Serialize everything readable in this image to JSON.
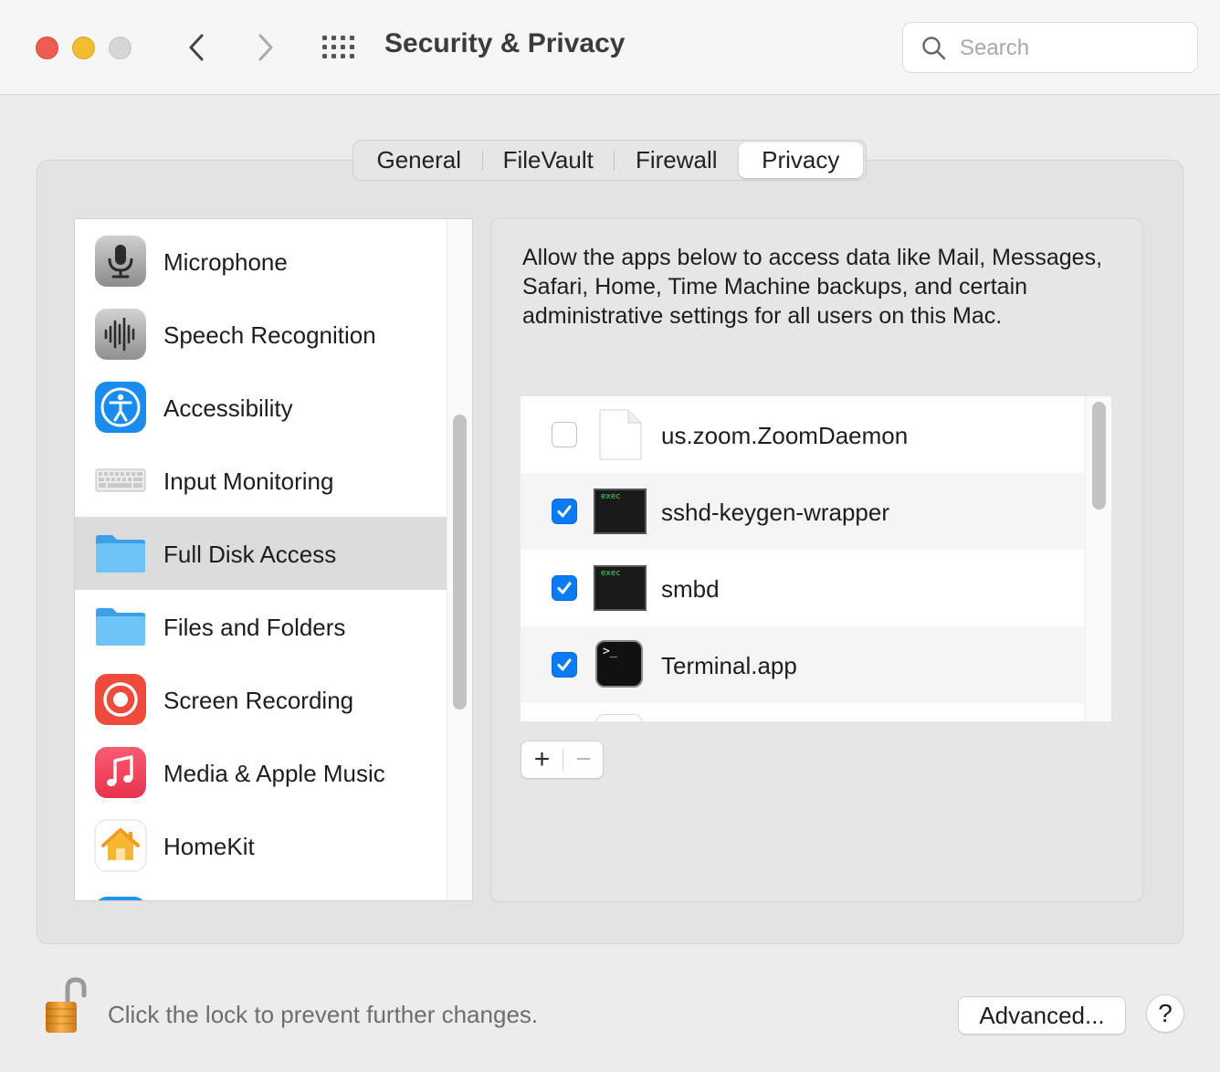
{
  "window": {
    "title": "Security & Privacy"
  },
  "search": {
    "placeholder": "Search",
    "icon": "magnifying-glass-icon"
  },
  "tabs": [
    {
      "label": "General",
      "selected": false
    },
    {
      "label": "FileVault",
      "selected": false
    },
    {
      "label": "Firewall",
      "selected": false
    },
    {
      "label": "Privacy",
      "selected": true
    }
  ],
  "sidebar": {
    "items": [
      {
        "label": "Microphone",
        "icon": "microphone-icon"
      },
      {
        "label": "Speech Recognition",
        "icon": "waveform-icon"
      },
      {
        "label": "Accessibility",
        "icon": "accessibility-icon"
      },
      {
        "label": "Input Monitoring",
        "icon": "keyboard-icon"
      },
      {
        "label": "Full Disk Access",
        "icon": "folder-icon",
        "selected": true
      },
      {
        "label": "Files and Folders",
        "icon": "folder-icon"
      },
      {
        "label": "Screen Recording",
        "icon": "screen-recording-icon"
      },
      {
        "label": "Media & Apple Music",
        "icon": "music-note-icon"
      },
      {
        "label": "HomeKit",
        "icon": "home-icon"
      }
    ]
  },
  "main": {
    "description": "Allow the apps below to access data like Mail, Messages, Safari, Home, Time Machine backups, and certain administrative settings for all users on this Mac.",
    "apps": [
      {
        "name": "us.zoom.ZoomDaemon",
        "checked": false,
        "icon": "blank-document-icon"
      },
      {
        "name": "sshd-keygen-wrapper",
        "checked": true,
        "icon": "exec-icon",
        "badge": "exec"
      },
      {
        "name": "smbd",
        "checked": true,
        "icon": "exec-icon",
        "badge": "exec"
      },
      {
        "name": "Terminal.app",
        "checked": true,
        "icon": "terminal-icon",
        "prompt": ">_"
      }
    ],
    "add_label": "+",
    "remove_label": "−"
  },
  "footer": {
    "lock_text": "Click the lock to prevent further changes.",
    "advanced_label": "Advanced...",
    "help_label": "?"
  },
  "colors": {
    "accent": "#0a7bf4",
    "close": "#ee5c53",
    "minimize": "#f5bc2f",
    "zoom_disabled": "#d6d6d6",
    "folder": "#5ab8f5",
    "accessibility": "#1a8cf0",
    "screen_recording": "#ef4b3c",
    "music": "#f0455b"
  }
}
